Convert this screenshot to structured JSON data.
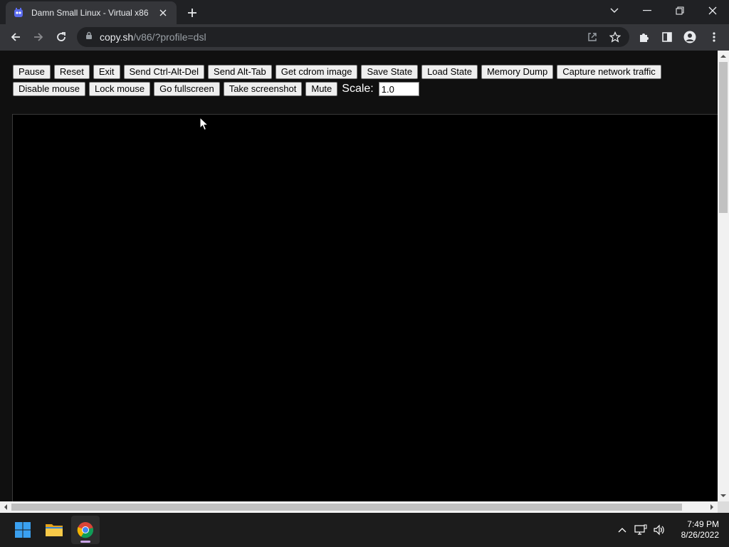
{
  "browser": {
    "tab_title": "Damn Small Linux - Virtual x86",
    "url_host": "copy.sh",
    "url_path": "/v86/?profile=dsl"
  },
  "controls": {
    "row1": [
      "Pause",
      "Reset",
      "Exit",
      "Send Ctrl-Alt-Del",
      "Send Alt-Tab",
      "Get cdrom image",
      "Save State",
      "Load State",
      "Memory Dump",
      "Capture network traffic"
    ],
    "row2": [
      "Disable mouse",
      "Lock mouse",
      "Go fullscreen",
      "Take screenshot",
      "Mute"
    ],
    "scale_label": "Scale:",
    "scale_value": "1.0"
  },
  "taskbar": {
    "time": "7:49 PM",
    "date": "8/26/2022"
  },
  "colors": {
    "page_bg": "#101010",
    "screen_bg": "#000000",
    "chrome_frame": "#202124",
    "chrome_toolbar": "#35363a"
  }
}
